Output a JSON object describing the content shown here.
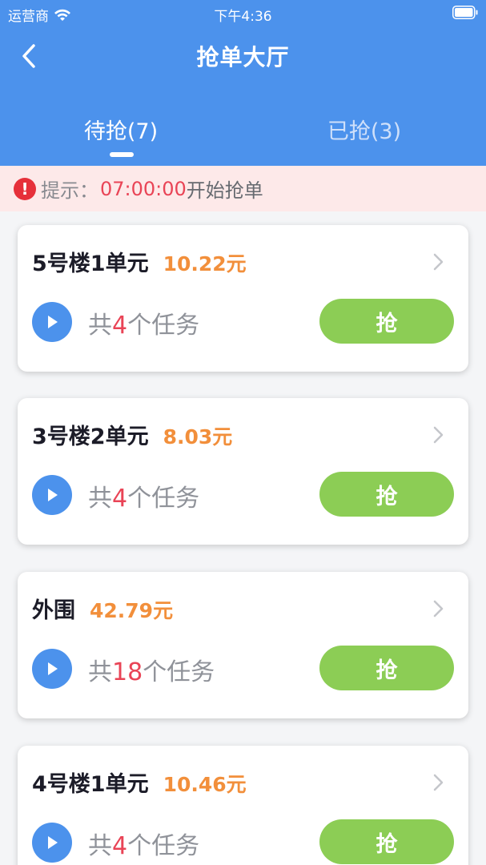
{
  "status_bar": {
    "carrier": "运营商",
    "time": "下午4:36"
  },
  "nav": {
    "title": "抢单大厅"
  },
  "tabs": [
    {
      "label": "待抢(7)",
      "active": true
    },
    {
      "label": "已抢(3)",
      "active": false
    }
  ],
  "notice": {
    "label": "提示：",
    "time": "07:00:00",
    "suffix": "开始抢单",
    "icon_glyph": "!"
  },
  "orders": [
    {
      "name": "5号楼1单元",
      "price": "10.22元",
      "count_prefix": "共",
      "count": "4",
      "count_suffix": "个任务",
      "button": "抢"
    },
    {
      "name": "3号楼2单元",
      "price": "8.03元",
      "count_prefix": "共",
      "count": "4",
      "count_suffix": "个任务",
      "button": "抢"
    },
    {
      "name": "外围",
      "price": "42.79元",
      "count_prefix": "共",
      "count": "18",
      "count_suffix": "个任务",
      "button": "抢"
    },
    {
      "name": "4号楼1单元",
      "price": "10.46元",
      "count_prefix": "共",
      "count": "4",
      "count_suffix": "个任务",
      "button": "抢"
    }
  ],
  "colors": {
    "header_bg": "#4c92ec",
    "price": "#f28f3b",
    "count_highlight": "#e94456",
    "grab_button": "#8ccd55",
    "notice_bg": "#fde9e9"
  }
}
